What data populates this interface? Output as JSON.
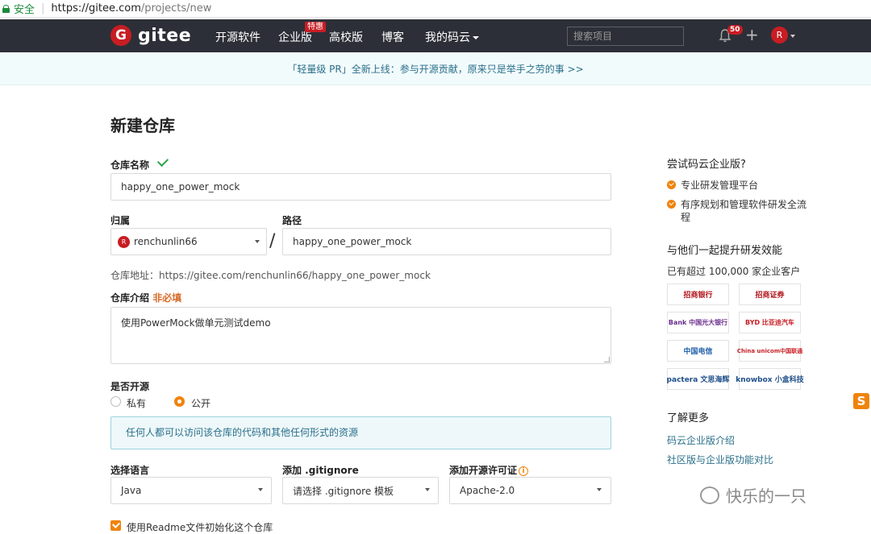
{
  "browser": {
    "secure_label": "安全",
    "url_host": "https://gitee.com",
    "url_path": "/projects/new"
  },
  "nav": {
    "logo_text": "gitee",
    "logo_mark": "G",
    "items": [
      "开源软件",
      "企业版",
      "高校版",
      "博客",
      "我的码云"
    ],
    "hot_badge": "特惠",
    "search_placeholder": "搜索项目",
    "notification_count": "50",
    "avatar_letter": "R"
  },
  "banner": {
    "text": "「轻量级 PR」全新上线：参与开源贡献，原来只是举手之劳的事 >>"
  },
  "form": {
    "title": "新建仓库",
    "repo_name_label": "仓库名称",
    "repo_name_value": "happy_one_power_mock",
    "owner_label": "归属",
    "owner_avatar": "R",
    "owner_value": "renchunlin66",
    "path_label": "路径",
    "path_value": "happy_one_power_mock",
    "address_label": "仓库地址：",
    "address_value": "https://gitee.com/renchunlin66/happy_one_power_mock",
    "intro_label": "仓库介绍",
    "intro_optional": "非必填",
    "intro_value": "使用PowerMock做单元测试demo",
    "open_label": "是否开源",
    "private_label": "私有",
    "public_label": "公开",
    "public_selected": true,
    "public_info": "任何人都可以访问该仓库的代码和其他任何形式的资源",
    "language_label": "选择语言",
    "language_value": "Java",
    "gitignore_label": "添加 .gitignore",
    "gitignore_value": "请选择 .gitignore 模板",
    "license_label": "添加开源许可证",
    "license_value": "Apache-2.0",
    "readme_label": "使用Readme文件初始化这个仓库",
    "readme_checked": true
  },
  "sidebar": {
    "try_title": "尝试码云企业版?",
    "features": [
      "专业研发管理平台",
      "有序规划和管理软件研发全流程"
    ],
    "together_title": "与他们一起提升研发效能",
    "customers_text": "已有超过 100,000 家企业客户",
    "logos": [
      "招商银行",
      "招商证券",
      "Bank 中国光大银行",
      "BYD 比亚迪汽车",
      "中国电信",
      "China unicom中国联通",
      "pactera 文思海辉",
      "knowbox 小盒科技"
    ],
    "more_title": "了解更多",
    "links": [
      "码云企业版介绍",
      "社区版与企业版功能对比"
    ]
  },
  "watermark": {
    "text": "快乐的一只"
  },
  "colors": {
    "nav_bg": "#2d2f38",
    "brand_red": "#c71d23",
    "accent_orange": "#f0830c",
    "link_blue": "#2a6f8a"
  }
}
